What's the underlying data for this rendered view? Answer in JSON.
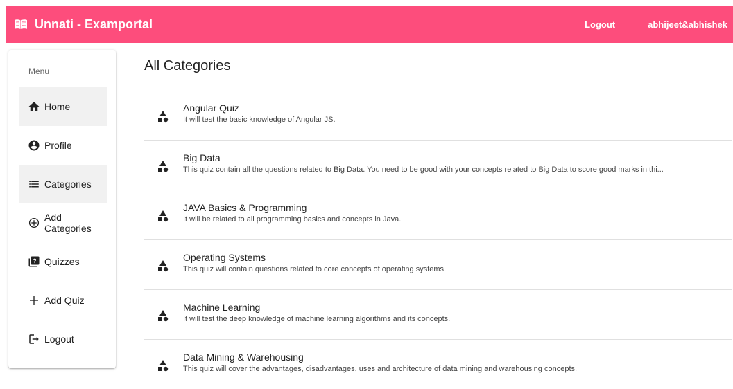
{
  "toolbar": {
    "brand": "Unnati - Examportal",
    "logout": "Logout",
    "username": "abhijeet&abhishek",
    "color": "#fd4d7c"
  },
  "sidebar": {
    "menu_label": "Menu",
    "items": [
      {
        "label": "Home",
        "icon": "home-icon",
        "active": true
      },
      {
        "label": "Profile",
        "icon": "account-circle-icon",
        "active": false
      },
      {
        "label": "Categories",
        "icon": "list-icon",
        "active": true
      },
      {
        "label": "Add\nCategories",
        "icon": "add-circle-outline-icon",
        "active": false
      },
      {
        "label": "Quizzes",
        "icon": "quiz-icon",
        "active": false
      },
      {
        "label": "Add Quiz",
        "icon": "add-icon",
        "active": false
      },
      {
        "label": "Logout",
        "icon": "logout-icon",
        "active": false
      }
    ]
  },
  "main": {
    "title": "All Categories",
    "categories": [
      {
        "title": "Angular Quiz",
        "description": "It will test the basic knowledge of Angular JS.",
        "icon": "category-shapes-icon"
      },
      {
        "title": "Big Data",
        "description": "This quiz contain all the questions related to Big Data. You need to be good with your concepts related to Big Data to score good marks in thi...",
        "icon": "category-shapes-icon"
      },
      {
        "title": "JAVA Basics & Programming",
        "description": "It will be related to all programming basics and concepts in Java.",
        "icon": "category-shapes-icon"
      },
      {
        "title": "Operating Systems",
        "description": "This quiz will contain questions related to core concepts of operating systems.",
        "icon": "category-shapes-icon"
      },
      {
        "title": "Machine Learning",
        "description": "It will test the deep knowledge of machine learning algorithms and its concepts.",
        "icon": "category-shapes-icon"
      },
      {
        "title": "Data Mining & Warehousing",
        "description": "This quiz will cover the advantages, disadvantages, uses and architecture of data mining and warehousing concepts.",
        "icon": "category-shapes-icon"
      }
    ]
  }
}
